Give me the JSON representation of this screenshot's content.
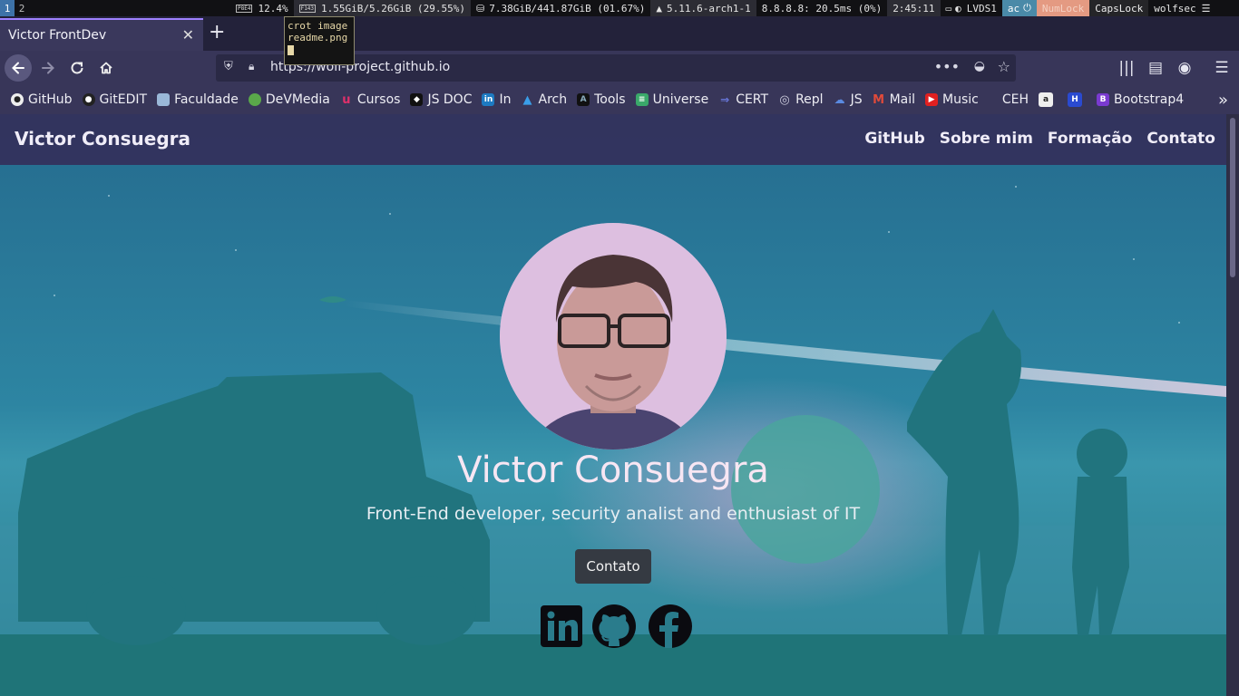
{
  "system_bar": {
    "workspaces": [
      "1",
      "2"
    ],
    "cpu_label": "P8E4",
    "cpu": "12.4%",
    "mem_label": "F143",
    "mem": "1.55GiB/5.26GiB (29.55%)",
    "disk": "7.38GiB/441.87GiB (01.67%)",
    "kernel": "5.11.6-arch1-1",
    "ping": "8.8.8.8: 20.5ms (0%)",
    "time": "2:45:11",
    "display": "LVDS1",
    "power": "ac",
    "numlock": "NumLock",
    "capslock": "CapsLock",
    "user": "wolfsec"
  },
  "popup": {
    "lines": [
      "crot image",
      "readme.png"
    ]
  },
  "browser": {
    "tab_title": "Victor FrontDev",
    "url": "https://wolf-project.github.io",
    "bookmarks": [
      "GitHub",
      "GitEDIT",
      "Faculdade",
      "DeVMedia",
      "Cursos",
      "JS DOC",
      "In",
      "Arch",
      "Tools",
      "Universe",
      "CERT",
      "Repl",
      "JS",
      "Mail",
      "Music",
      "CEH",
      "",
      "",
      "Bootstrap4"
    ]
  },
  "site": {
    "brand": "Victor Consuegra",
    "nav": [
      "GitHub",
      "Sobre mim",
      "Formação",
      "Contato"
    ],
    "hero_title": "Victor Consuegra",
    "hero_subtitle": "Front-End developer, security analist and enthusiast of IT",
    "hero_button": "Contato",
    "social": [
      "linkedin-icon",
      "github-icon",
      "facebook-icon"
    ]
  },
  "colors": {
    "accent": "#9e80ff",
    "nav_bg": "#342c58",
    "hero_bg": "#2d85a2"
  }
}
